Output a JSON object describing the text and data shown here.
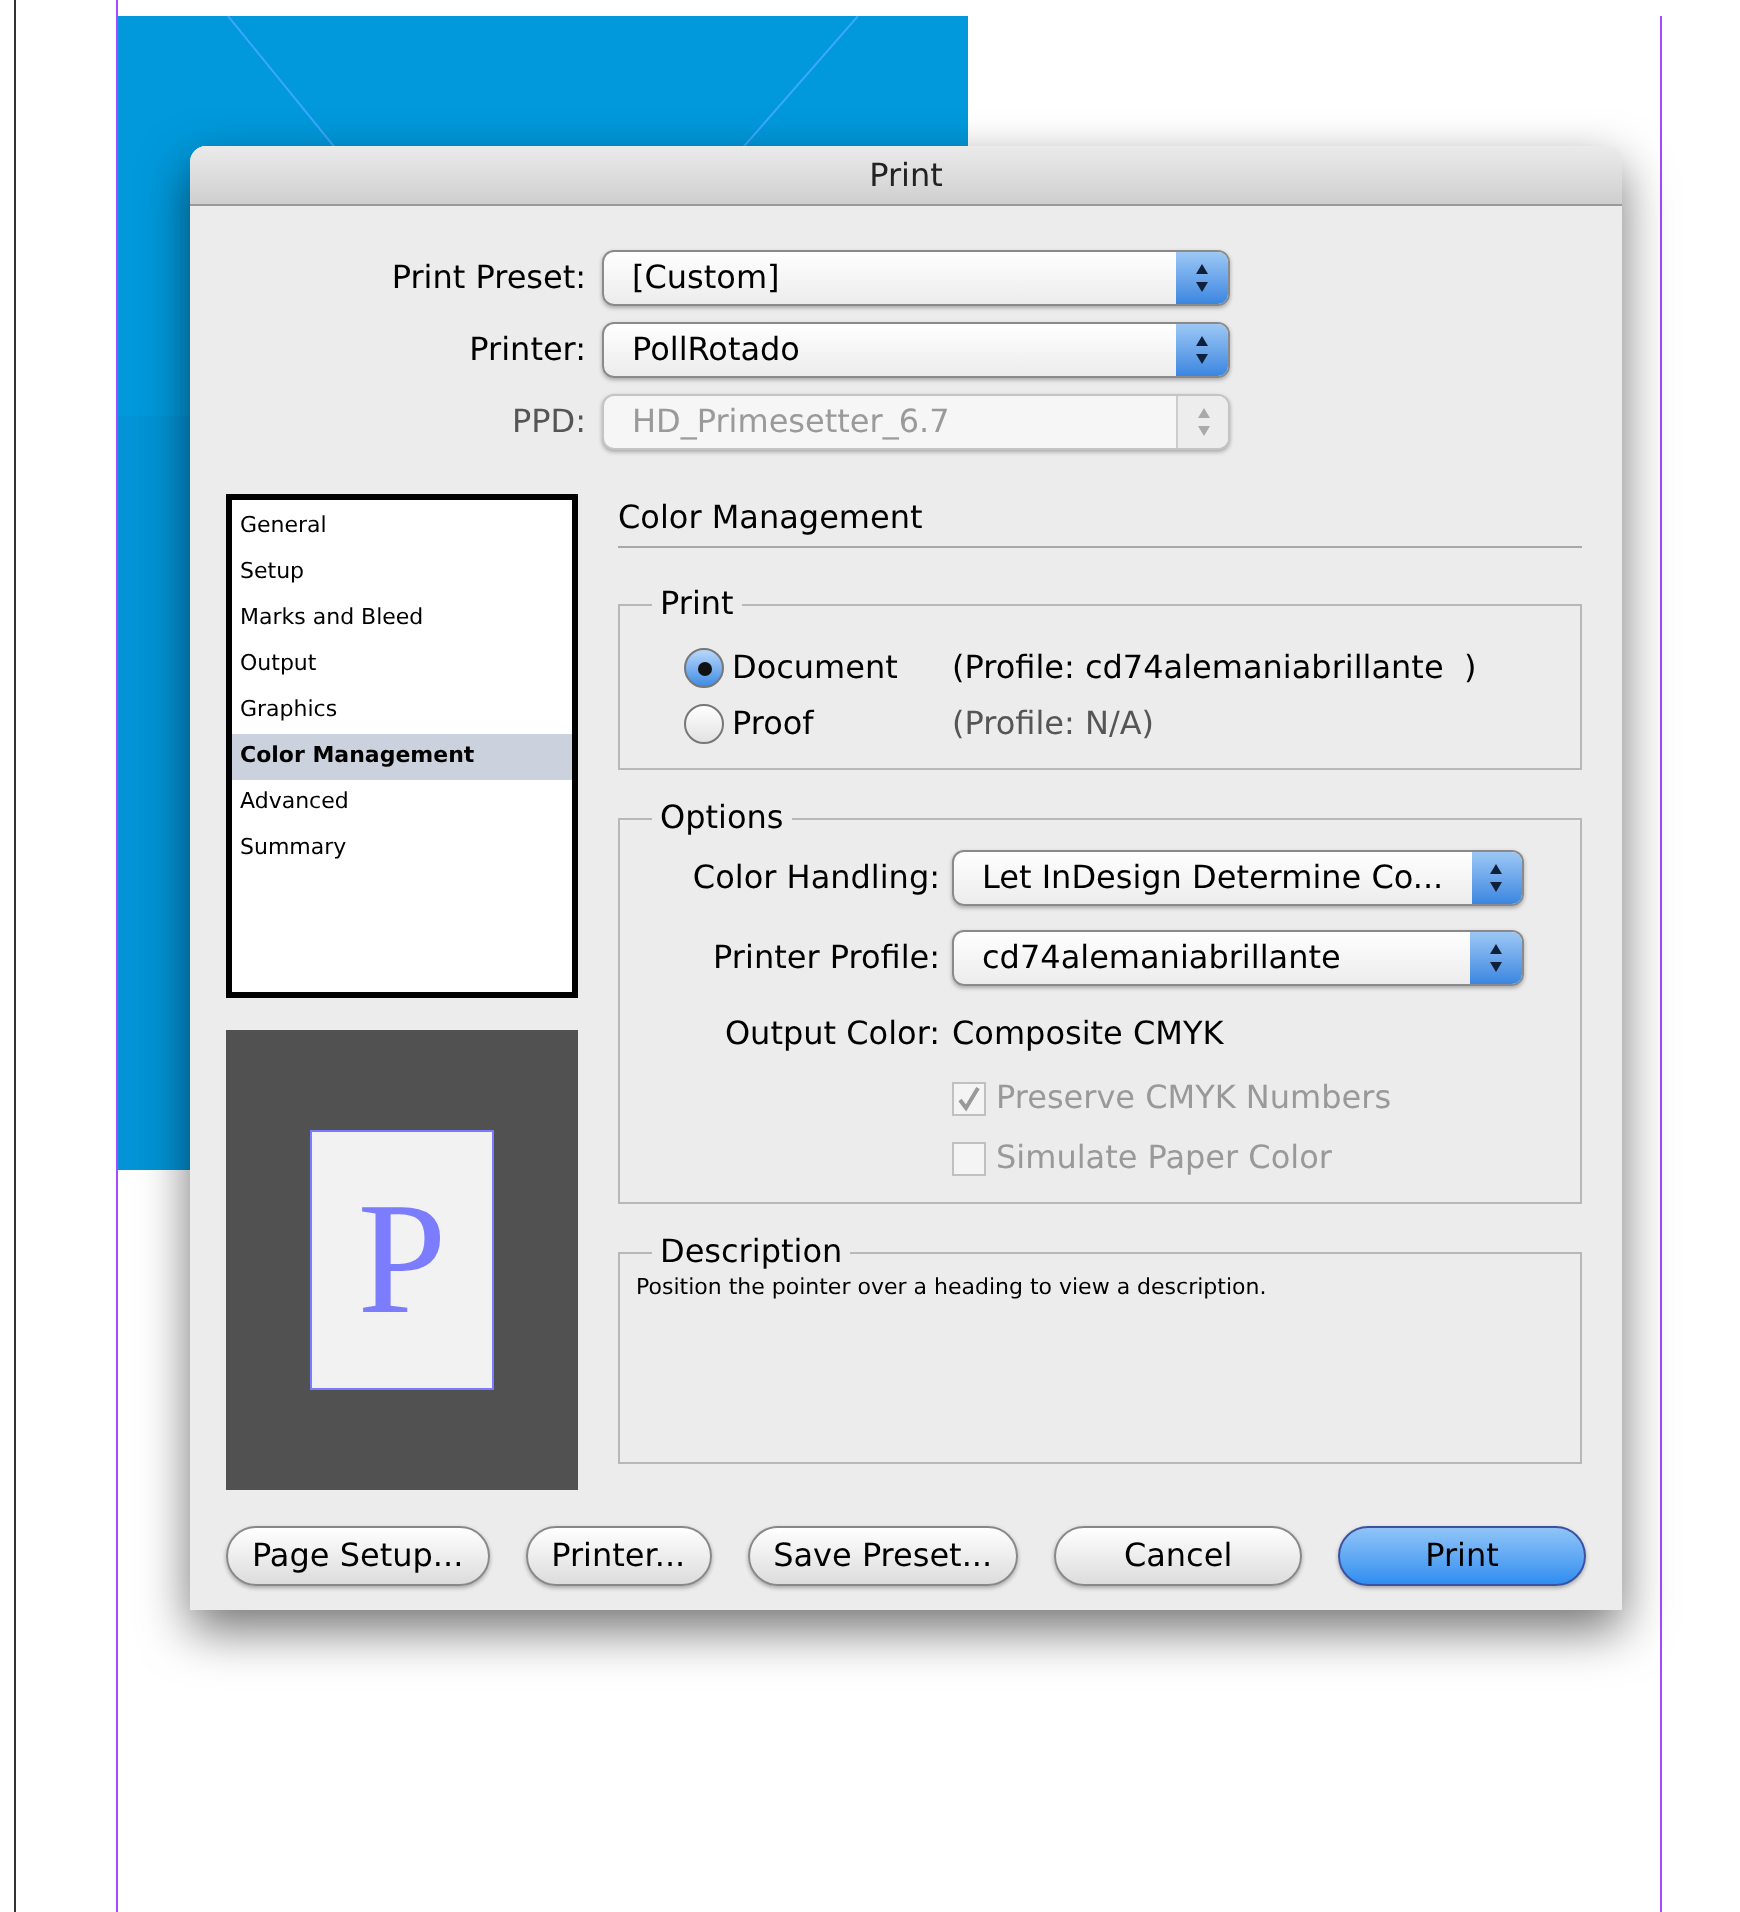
{
  "window": {
    "title": "Print"
  },
  "top_fields": [
    {
      "label": "Print Preset:",
      "value": "[Custom]",
      "disabled": false
    },
    {
      "label": "Printer:",
      "value": "PollRotado",
      "disabled": false
    },
    {
      "label": "PPD:",
      "value": "HD_Primesetter_6.7",
      "disabled": true
    }
  ],
  "sidebar": {
    "items": [
      {
        "label": "General",
        "selected": false
      },
      {
        "label": "Setup",
        "selected": false
      },
      {
        "label": "Marks and Bleed",
        "selected": false
      },
      {
        "label": "Output",
        "selected": false
      },
      {
        "label": "Graphics",
        "selected": false
      },
      {
        "label": "Color Management",
        "selected": true
      },
      {
        "label": "Advanced",
        "selected": false
      },
      {
        "label": "Summary",
        "selected": false
      }
    ]
  },
  "preview": {
    "letter": "P"
  },
  "section_title": "Color Management",
  "print_group": {
    "title": "Print",
    "options": [
      {
        "label": "Document",
        "profile": "(Profile: cd74alemaniabrillante  )",
        "selected": true
      },
      {
        "label": "Proof",
        "profile": "(Profile: N/A)",
        "selected": false
      }
    ]
  },
  "options_group": {
    "title": "Options",
    "selects": [
      {
        "label": "Color Handling:",
        "value": "Let InDesign Determine Co..."
      },
      {
        "label": "Printer Profile:",
        "value": "cd74alemaniabrillante"
      }
    ],
    "output_color": {
      "label": "Output Color:",
      "value": "Composite CMYK"
    },
    "checkboxes": [
      {
        "label": "Preserve CMYK Numbers",
        "checked": true,
        "disabled": true
      },
      {
        "label": "Simulate Paper Color",
        "checked": false,
        "disabled": true
      }
    ]
  },
  "description": {
    "title": "Description",
    "text": "Position the pointer over a heading to view a description."
  },
  "buttons": [
    {
      "label": "Page Setup...",
      "default": false
    },
    {
      "label": "Printer...",
      "default": false
    },
    {
      "label": "Save Preset...",
      "default": false
    },
    {
      "label": "Cancel",
      "default": false
    },
    {
      "label": "Print",
      "default": true
    }
  ]
}
